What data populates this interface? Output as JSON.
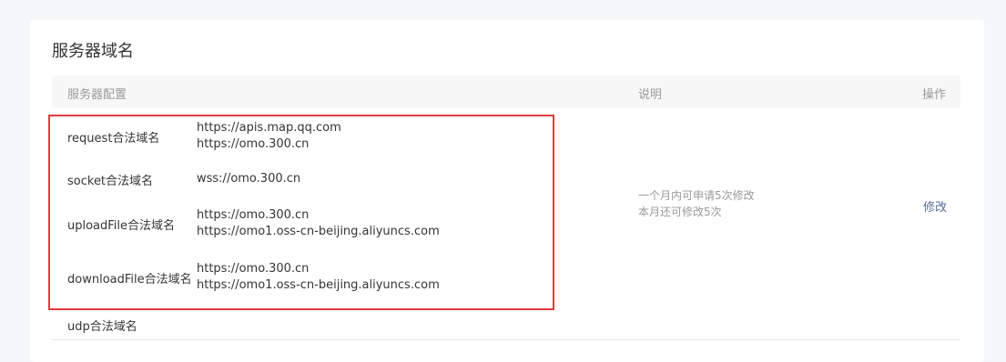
{
  "section": {
    "title": "服务器域名"
  },
  "table": {
    "headers": {
      "config": "服务器配置",
      "desc": "说明",
      "op": "操作"
    },
    "rows": [
      {
        "name": "request合法域名",
        "values": [
          "https://apis.map.qq.com",
          "https://omo.300.cn"
        ]
      },
      {
        "name": "socket合法域名",
        "values": [
          "wss://omo.300.cn"
        ]
      },
      {
        "name": "uploadFile合法域名",
        "values": [
          "https://omo.300.cn",
          "https://omo1.oss-cn-beijing.aliyuncs.com"
        ]
      },
      {
        "name": "downloadFile合法域名",
        "values": [
          "https://omo.300.cn",
          "https://omo1.oss-cn-beijing.aliyuncs.com"
        ]
      },
      {
        "name": "udp合法域名",
        "values": []
      }
    ],
    "description": [
      "一个月内可申请5次修改",
      "本月还可修改5次"
    ],
    "action_label": "修改"
  },
  "annotation": {
    "highlight_color": "#e5393b"
  },
  "colors": {
    "link": "#576b95",
    "muted": "#9a9a9a",
    "text": "#353535"
  }
}
